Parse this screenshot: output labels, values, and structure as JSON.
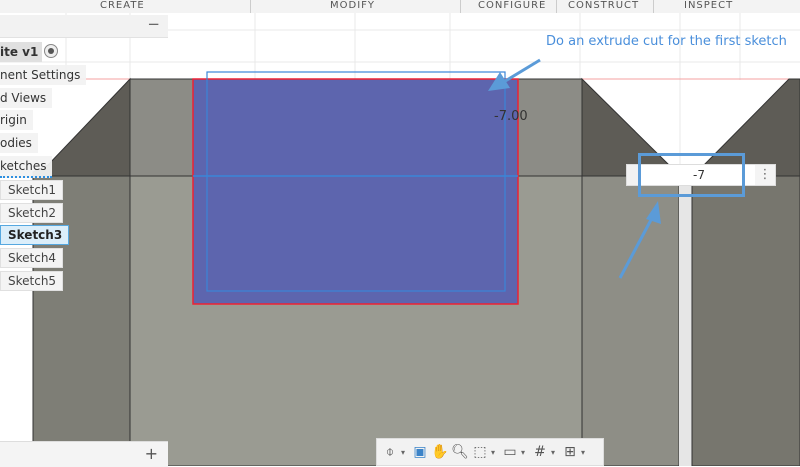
{
  "toolbar": {
    "tabs": [
      "CREATE",
      "MODIFY",
      "CONFIGURE",
      "CONSTRUCT",
      "INSPECT"
    ]
  },
  "browser": {
    "collapse_label": "−",
    "nodes": [
      "ite v1",
      "nent Settings",
      "d Views",
      "rigin",
      "odies",
      "ketches"
    ],
    "sketches": [
      "Sketch1",
      "Sketch2",
      "Sketch3",
      "Sketch4",
      "Sketch5"
    ],
    "active_sketch": "Sketch3"
  },
  "annotation": {
    "text": "Do an extrude cut for the first sketch",
    "color": "#4a8fdb"
  },
  "dimension": {
    "label": "-7.00",
    "input_value": "-7",
    "more": "⋮"
  },
  "navbar": {
    "icons": [
      "orbit-icon",
      "look-at-icon",
      "pan-icon",
      "zoom-icon",
      "fit-icon",
      "display-settings-icon",
      "grid-icon",
      "viewports-icon"
    ]
  },
  "bottom_panel": {
    "add_label": "+"
  },
  "colors": {
    "profile": "#5d65ae",
    "body_face": "#9a9a92",
    "chamfer": "#5e5c56"
  }
}
